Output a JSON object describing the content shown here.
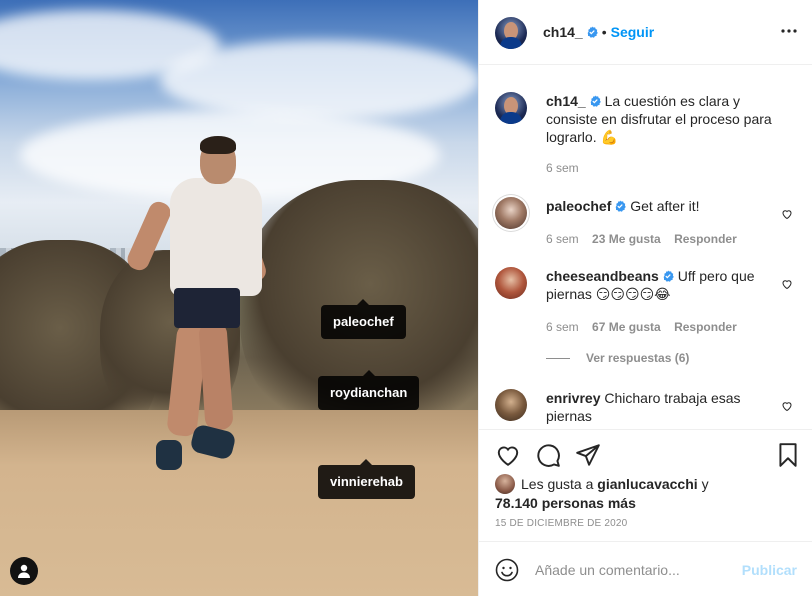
{
  "post": {
    "author": "ch14_",
    "follow_label": "Seguir",
    "dot": "•",
    "caption": "La cuestión es clara y consiste en disfrutar el proceso para lograrlo. 💪",
    "caption_time": "6 sem",
    "tags": [
      "paleochef",
      "roydianchan",
      "vinnierehab"
    ]
  },
  "comments": [
    {
      "author": "paleochef",
      "verified": true,
      "text": "Get after it!",
      "time": "6 sem",
      "likes": "23 Me gusta",
      "reply_label": "Responder"
    },
    {
      "author": "cheeseandbeans",
      "verified": true,
      "text": "Uff pero que piernas 😏😏😏😏😂",
      "time": "6 sem",
      "likes": "67 Me gusta",
      "reply_label": "Responder"
    },
    {
      "author": "enrivrey",
      "verified": false,
      "text": "Chicharo trabaja esas piernas"
    }
  ],
  "view_replies": "Ver respuestas (6)",
  "likes_line": {
    "prefix": "Les gusta a",
    "user": "gianlucavacchi",
    "suffix": "y",
    "count": "78.140 personas más"
  },
  "date": "15 DE DICIEMBRE DE 2020",
  "add_comment": {
    "placeholder": "Añade un comentario...",
    "publish_label": "Publicar"
  },
  "icons": {
    "more": "more-horizontal-icon",
    "like": "heart-icon",
    "comment": "comment-icon",
    "share": "share-icon",
    "save": "bookmark-icon",
    "emoji": "emoji-icon",
    "tagged_users": "user-tag-icon",
    "verified": "verified-badge-icon"
  },
  "colors": {
    "link_blue": "#0095f6",
    "publish_disabled": "#b2dffc",
    "verified": "#3897f0",
    "muted": "#8e8e8e"
  }
}
